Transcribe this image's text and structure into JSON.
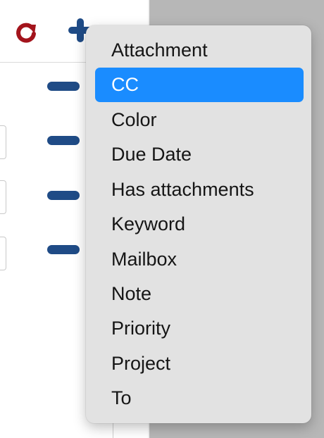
{
  "toolbar": {
    "refresh_icon": "refresh-icon",
    "add_icon": "plus-icon",
    "refresh_color": "#a3141c",
    "add_color": "#1f4b86"
  },
  "rules": [
    {
      "action": "remove",
      "icon": "minus-icon"
    },
    {
      "action": "remove",
      "icon": "minus-icon"
    },
    {
      "action": "remove",
      "icon": "minus-icon"
    },
    {
      "action": "remove",
      "icon": "minus-icon"
    }
  ],
  "menu": {
    "selected_index": 1,
    "accent_color": "#1a8cff",
    "items": [
      {
        "label": "Attachment"
      },
      {
        "label": "CC"
      },
      {
        "label": "Color"
      },
      {
        "label": "Due Date"
      },
      {
        "label": "Has attachments"
      },
      {
        "label": "Keyword"
      },
      {
        "label": "Mailbox"
      },
      {
        "label": "Note"
      },
      {
        "label": "Priority"
      },
      {
        "label": "Project"
      },
      {
        "label": "To"
      }
    ]
  }
}
